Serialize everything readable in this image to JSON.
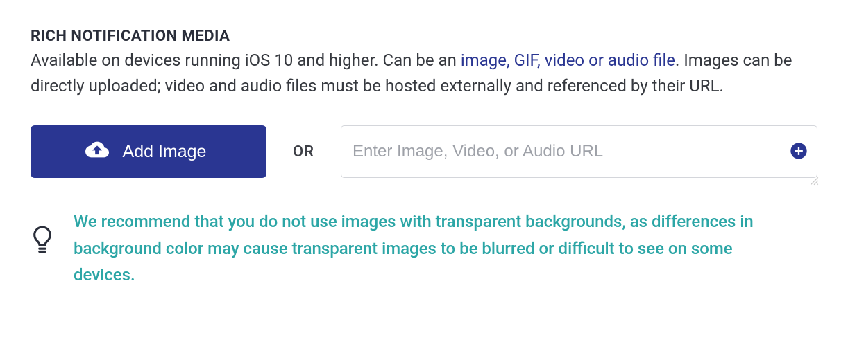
{
  "section": {
    "title": "RICH NOTIFICATION MEDIA",
    "desc_prefix": "Available on devices running iOS 10 and higher. Can be an ",
    "desc_link": "image, GIF, video or audio file",
    "desc_suffix": ". Images can be directly uploaded; video and audio files must be hosted externally and referenced by their URL."
  },
  "controls": {
    "add_image_label": "Add Image",
    "or_label": "OR",
    "url_placeholder": "Enter Image, Video, or Audio URL"
  },
  "tip": {
    "text": "We recommend that you do not use images with transparent backgrounds, as differences in background color may cause transparent images to be blurred or difficult to see on some devices."
  }
}
